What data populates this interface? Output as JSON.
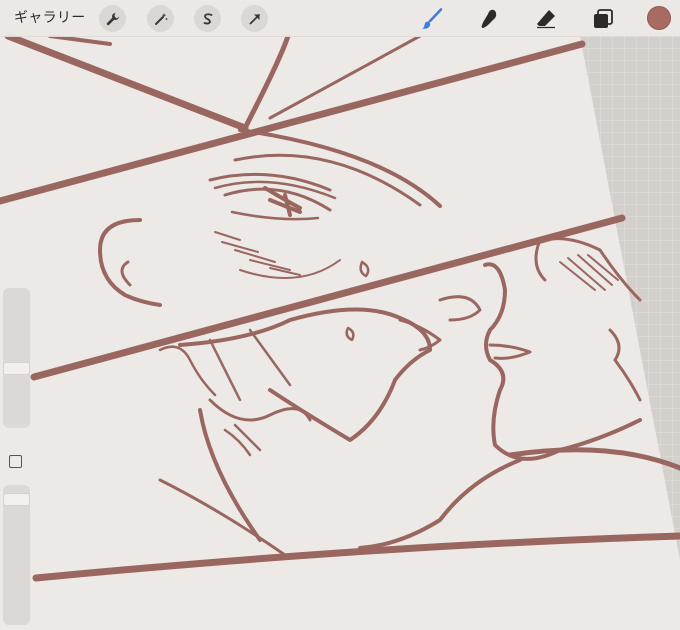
{
  "toolbar": {
    "gallery_label": "ギャラリー",
    "actions_icon": "wrench-icon",
    "adjustments_icon": "magic-wand-icon",
    "selection_icon": "selection-s-icon",
    "transform_icon": "transform-arrow-icon",
    "brush_icon": "brush-icon",
    "smudge_icon": "smudge-icon",
    "eraser_icon": "eraser-icon",
    "layers_icon": "layers-icon",
    "active_tool": "brush",
    "active_tool_color": "#3d7fd6",
    "current_color": "#a86a62"
  },
  "sidebar": {
    "brush_size_icon": "slider-track",
    "modify_icon": "square-icon",
    "opacity_icon": "slider-track"
  },
  "canvas": {
    "line_color": "#9a6760",
    "paper_color": "#ece9e6",
    "grid_background": "#d3cfcb"
  }
}
